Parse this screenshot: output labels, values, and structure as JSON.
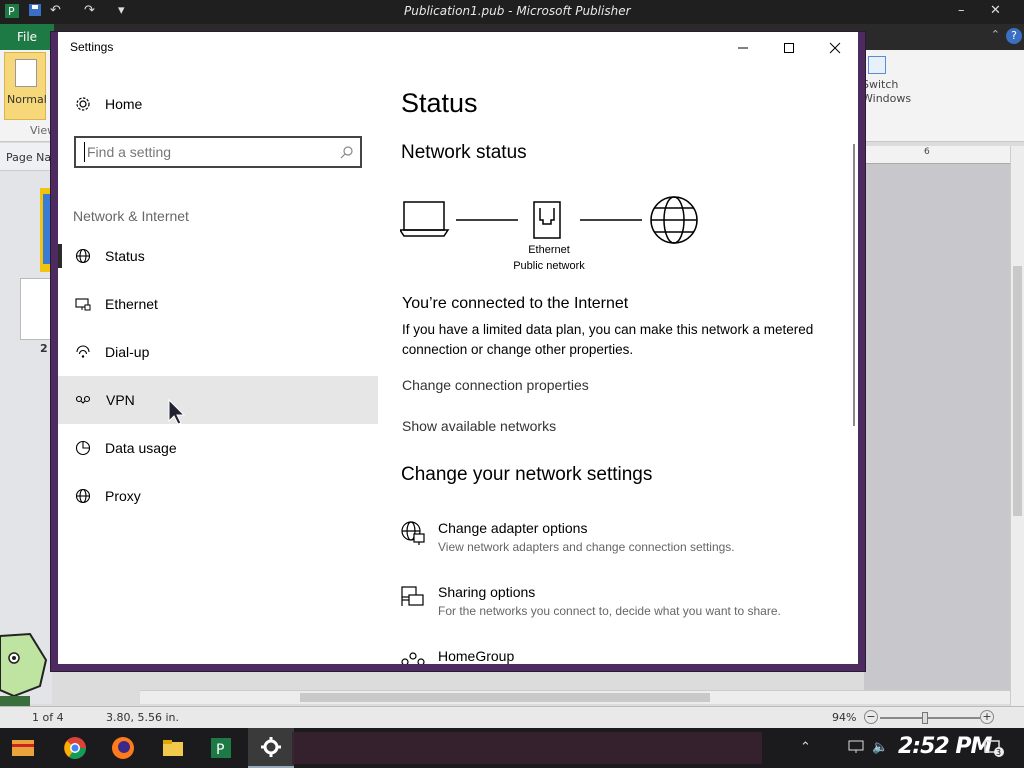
{
  "publisher": {
    "window_title": "Publication1.pub - Microsoft Publisher",
    "file_tab": "File",
    "normal_label": "Normal",
    "view_label": "View",
    "switch_windows": "Switch Windows",
    "page_nav_label": "Page Navigation",
    "thumb_number": "2",
    "ruler_mark": "6",
    "status_page": "1 of 4",
    "status_coords": "3.80, 5.56 in.",
    "zoom": "94%"
  },
  "settings": {
    "window_title": "Settings",
    "home_label": "Home",
    "search_placeholder": "Find a setting",
    "section_heading": "Network & Internet",
    "nav_items": [
      {
        "label": "Status",
        "icon": "globe-icon"
      },
      {
        "label": "Ethernet",
        "icon": "ethernet-icon"
      },
      {
        "label": "Dial-up",
        "icon": "dialup-icon"
      },
      {
        "label": "VPN",
        "icon": "vpn-icon"
      },
      {
        "label": "Data usage",
        "icon": "data-usage-icon"
      },
      {
        "label": "Proxy",
        "icon": "proxy-globe-icon"
      }
    ],
    "selected_item": "Status",
    "hovered_item": "VPN"
  },
  "status": {
    "page_title": "Status",
    "network_status_heading": "Network status",
    "diagram": {
      "adapter_label": "Ethernet",
      "network_label": "Public network"
    },
    "connected_heading": "You’re connected to the Internet",
    "connected_desc": "If you have a limited data plan, you can make this network a metered connection or change other properties.",
    "link_change_props": "Change connection properties",
    "link_show_networks": "Show available networks",
    "change_heading": "Change your network settings",
    "options": [
      {
        "title": "Change adapter options",
        "desc": "View network adapters and change connection settings."
      },
      {
        "title": "Sharing options",
        "desc": "For the networks you connect to, decide what you want to share."
      },
      {
        "title": "HomeGroup",
        "desc": ""
      }
    ]
  },
  "taskbar": {
    "clock": "2:52 PM",
    "notification_count": "3"
  }
}
